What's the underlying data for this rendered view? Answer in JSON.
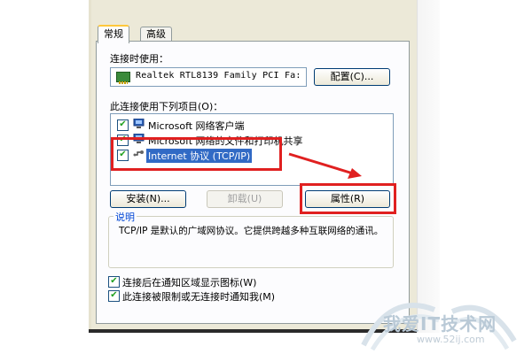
{
  "tabs": [
    {
      "label": "常规",
      "active": true
    },
    {
      "label": "高级",
      "active": false
    }
  ],
  "connect_using_label": "连接时使用：",
  "adapter_name": "Realtek RTL8139 Family PCI Fa:",
  "configure_button": "配置(C)...",
  "components_label": "此连接使用下列项目(O)：",
  "components": [
    {
      "label": "Microsoft 网络客户端",
      "checked": true,
      "icon": "network-client-icon",
      "selected": false
    },
    {
      "label": "Microsoft 网络的文件和打印机共享",
      "checked": true,
      "icon": "file-printer-sharing-icon",
      "selected": false
    },
    {
      "label": "Internet 协议 (TCP/IP)",
      "checked": true,
      "icon": "protocol-icon",
      "selected": true
    }
  ],
  "buttons": {
    "install": "安装(N)...",
    "uninstall": "卸载(U)",
    "properties": "属性(R)"
  },
  "description": {
    "title": "说明",
    "text": "TCP/IP 是默认的广域网协议。它提供跨越多种互联网络的通讯。"
  },
  "options": [
    {
      "label": "连接后在通知区域显示图标(W)",
      "checked": true
    },
    {
      "label": "此连接被限制或无连接时通知我(M)",
      "checked": true
    }
  ],
  "watermark": {
    "site": "我爱IT技术网",
    "url": "www.52ij.com"
  },
  "colors": {
    "annotation_red": "#e02020",
    "selection_blue": "#316ac5",
    "dialog_bg": "#ece9d8"
  }
}
